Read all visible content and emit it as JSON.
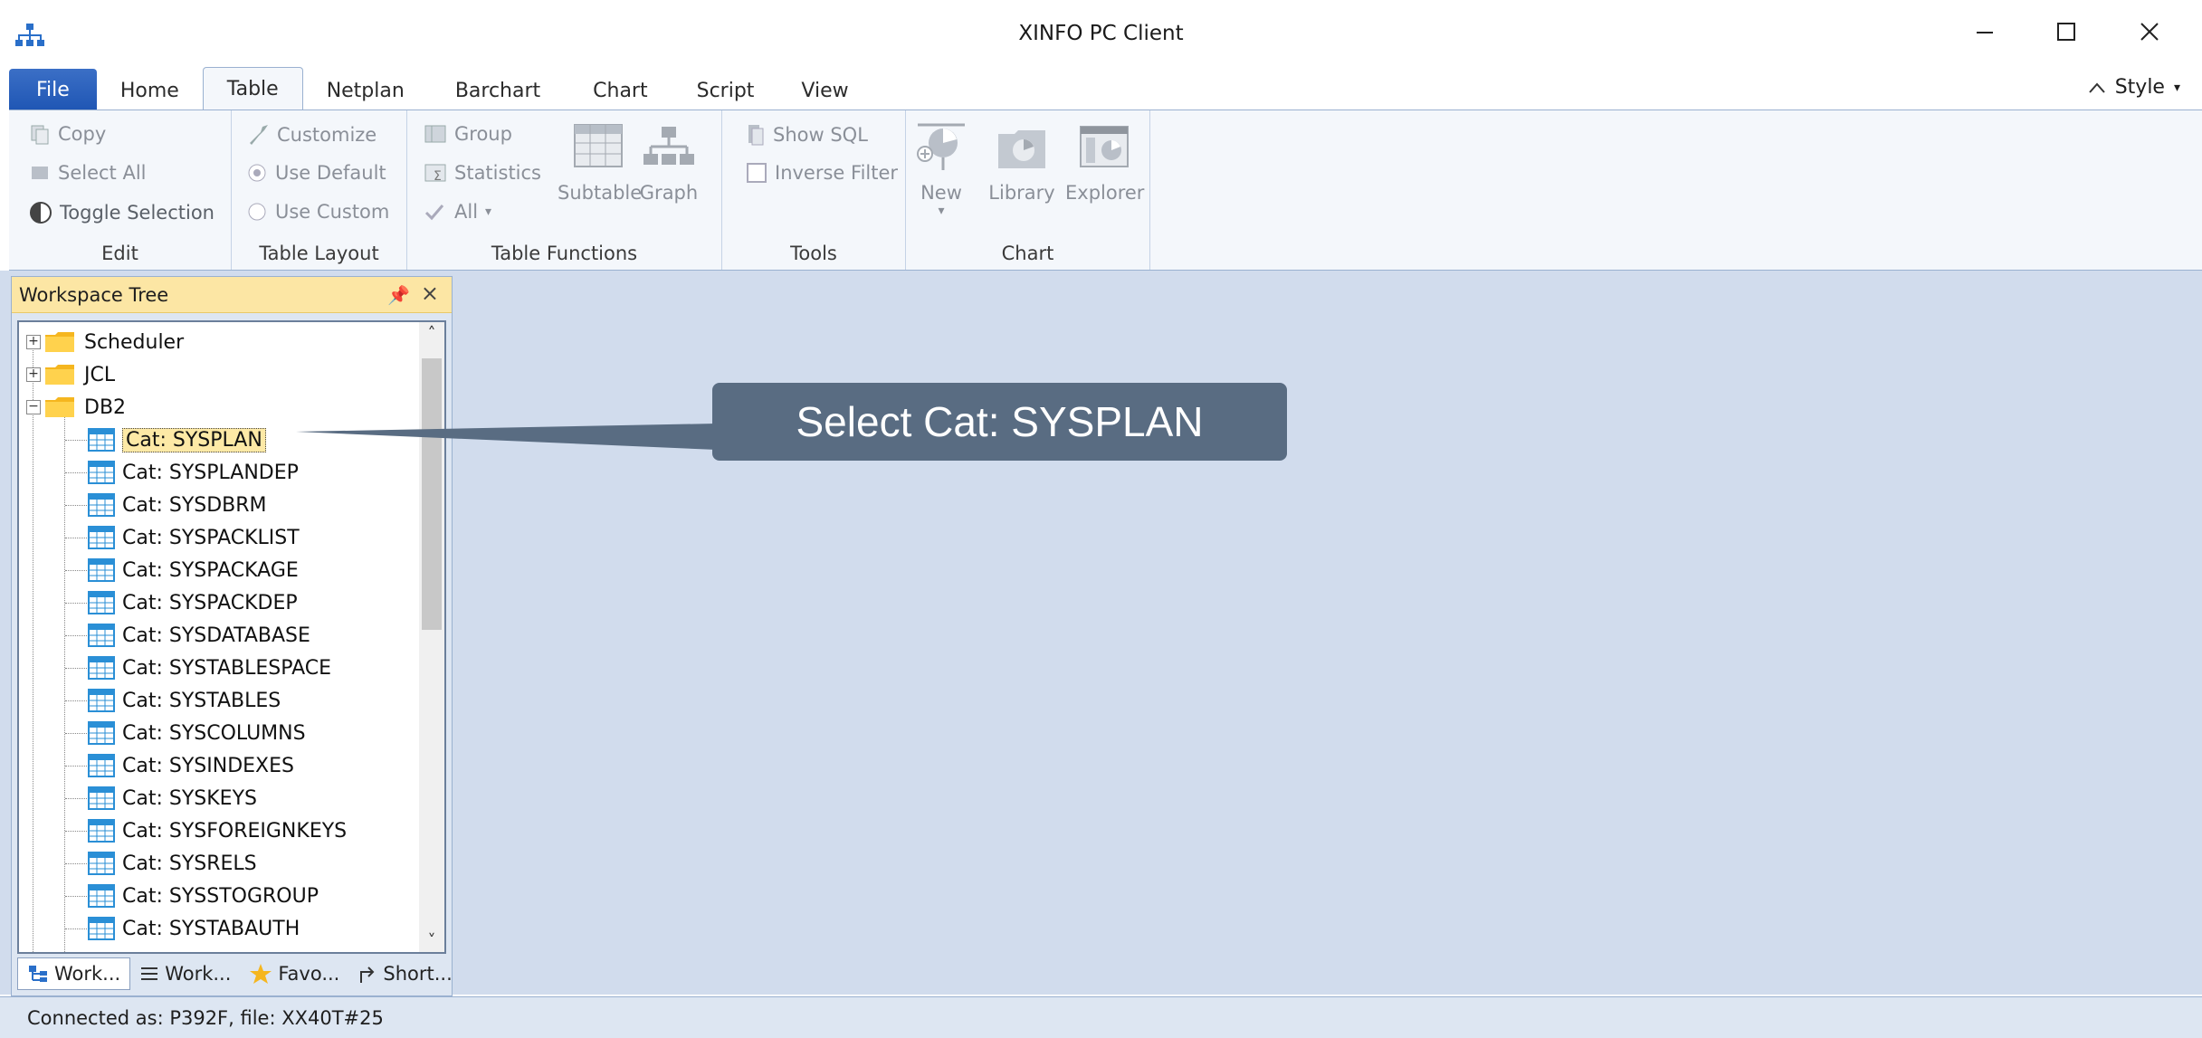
{
  "window": {
    "title": "XINFO PC Client"
  },
  "ribbon_tabs": [
    {
      "label": "File"
    },
    {
      "label": "Home"
    },
    {
      "label": "Table"
    },
    {
      "label": "Netplan"
    },
    {
      "label": "Barchart"
    },
    {
      "label": "Chart"
    },
    {
      "label": "Script"
    },
    {
      "label": "View"
    }
  ],
  "active_tab": "Table",
  "style_menu": "Style",
  "groups": {
    "edit": {
      "label": "Edit",
      "copy": "Copy",
      "select_all": "Select All",
      "toggle_selection": "Toggle Selection"
    },
    "table_layout": {
      "label": "Table Layout",
      "customize": "Customize",
      "use_default": "Use Default",
      "use_custom": "Use Custom"
    },
    "table_functions": {
      "label": "Table Functions",
      "group": "Group",
      "statistics": "Statistics",
      "all": "All",
      "subtable": "Subtable",
      "graph": "Graph"
    },
    "tools": {
      "label": "Tools",
      "show_sql": "Show SQL",
      "inverse_filter": "Inverse Filter"
    },
    "chart": {
      "label": "Chart",
      "new": "New",
      "library": "Library",
      "explorer": "Explorer"
    }
  },
  "workspace_panel": {
    "title": "Workspace Tree",
    "roots": [
      {
        "label": "Scheduler",
        "expanded": false
      },
      {
        "label": "JCL",
        "expanded": false
      },
      {
        "label": "DB2",
        "expanded": true
      }
    ],
    "db2_children": [
      "Cat: SYSPLAN",
      "Cat: SYSPLANDEP",
      "Cat: SYSDBRM",
      "Cat: SYSPACKLIST",
      "Cat: SYSPACKAGE",
      "Cat: SYSPACKDEP",
      "Cat: SYSDATABASE",
      "Cat: SYSTABLESPACE",
      "Cat: SYSTABLES",
      "Cat: SYSCOLUMNS",
      "Cat: SYSINDEXES",
      "Cat: SYSKEYS",
      "Cat: SYSFOREIGNKEYS",
      "Cat: SYSRELS",
      "Cat: SYSSTOGROUP",
      "Cat: SYSTABAUTH"
    ],
    "selected": "Cat: SYSPLAN",
    "bottom_tabs": [
      {
        "label": "Work...",
        "icon": "tree-icon"
      },
      {
        "label": "Work...",
        "icon": "list-icon"
      },
      {
        "label": "Favo...",
        "icon": "star-icon"
      },
      {
        "label": "Short...",
        "icon": "shortcut-arrow-icon"
      }
    ]
  },
  "callout": {
    "text": "Select Cat: SYSPLAN"
  },
  "status": {
    "text": "Connected as: P392F, file: XX40T#25"
  }
}
